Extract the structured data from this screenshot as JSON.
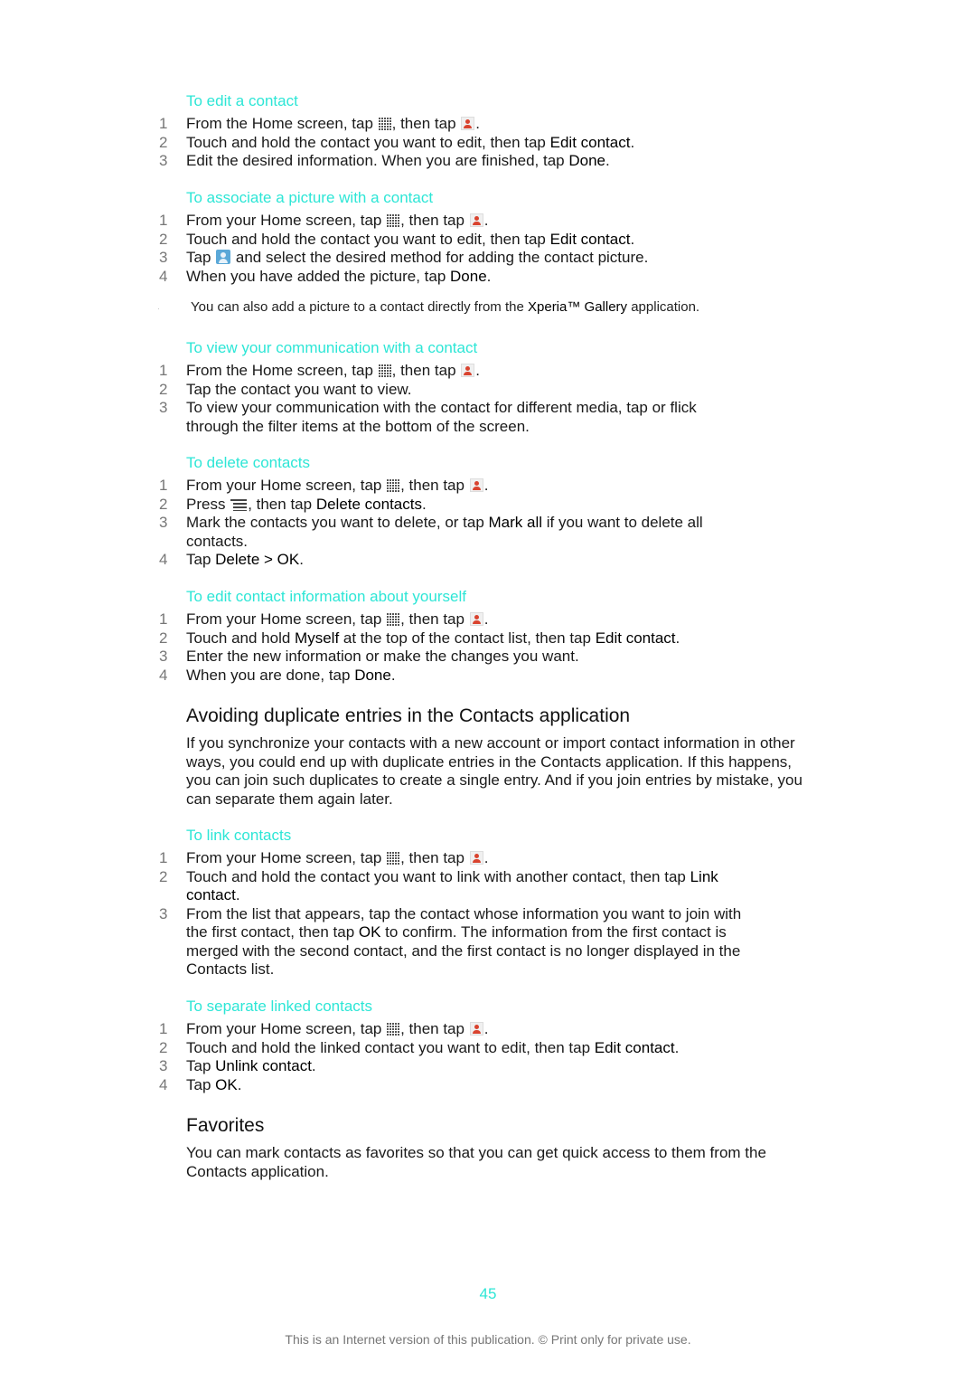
{
  "sections": {
    "edit_contact": {
      "title": "To edit a contact",
      "steps": [
        {
          "n": "1",
          "a": "From the Home screen, tap ",
          "b": ", then tap ",
          "c": "."
        },
        {
          "n": "2",
          "a": "Touch and hold the contact you want to edit, then tap ",
          "bold": "Edit contact",
          "c": "."
        },
        {
          "n": "3",
          "a": "Edit the desired information. When you are finished, tap ",
          "bold": "Done",
          "c": "."
        }
      ]
    },
    "associate_picture": {
      "title": "To associate a picture with a contact",
      "steps": [
        {
          "n": "1",
          "a": "From your Home screen, tap ",
          "b": ", then tap ",
          "c": "."
        },
        {
          "n": "2",
          "a": "Touch and hold the contact you want to edit, then tap ",
          "bold": "Edit contact",
          "c": "."
        },
        {
          "n": "3",
          "a": "Tap ",
          "b": " and select the desired method for adding the contact picture."
        },
        {
          "n": "4",
          "a": "When you have added the picture, tap ",
          "bold": "Done",
          "c": "."
        }
      ],
      "note": {
        "a": "You can also add a picture to a contact directly from the ",
        "bold": "Xperia™ Gallery",
        "c": " application."
      }
    },
    "view_communication": {
      "title": "To view your communication with a contact",
      "steps": [
        {
          "n": "1",
          "a": "From the Home screen, tap ",
          "b": ", then tap ",
          "c": "."
        },
        {
          "n": "2",
          "a": "Tap the contact you want to view."
        },
        {
          "n": "3",
          "a": "To view your communication with the contact for different media, tap or flick through the filter items at the bottom of the screen."
        }
      ]
    },
    "delete_contacts": {
      "title": "To delete contacts",
      "steps": [
        {
          "n": "1",
          "a": "From your Home screen, tap ",
          "b": ", then tap ",
          "c": "."
        },
        {
          "n": "2",
          "a": "Press ",
          "b": ", then tap ",
          "bold": "Delete contacts",
          "c": "."
        },
        {
          "n": "3",
          "a": "Mark the contacts you want to delete, or tap ",
          "bold": "Mark all",
          "c": " if you want to delete all contacts."
        },
        {
          "n": "4",
          "a": "Tap ",
          "bold": "Delete > OK",
          "c": "."
        }
      ]
    },
    "edit_yourself": {
      "title": "To edit contact information about yourself",
      "steps": [
        {
          "n": "1",
          "a": "From your Home screen, tap ",
          "b": ", then tap ",
          "c": "."
        },
        {
          "n": "2",
          "a": "Touch and hold ",
          "bold": "Myself",
          "b": " at the top of the contact list, then tap ",
          "bold2": "Edit contact",
          "c": "."
        },
        {
          "n": "3",
          "a": "Enter the new information or make the changes you want."
        },
        {
          "n": "4",
          "a": "When you are done, tap ",
          "bold": "Done",
          "c": "."
        }
      ]
    },
    "avoiding": {
      "heading": "Avoiding duplicate entries in the Contacts application",
      "paragraph": "If you synchronize your contacts with a new account or import contact information in other ways, you could end up with duplicate entries in the Contacts application. If this happens, you can join such duplicates to create a single entry. And if you join entries by mistake, you can separate them again later."
    },
    "link_contacts": {
      "title": "To link contacts",
      "steps": [
        {
          "n": "1",
          "a": "From your Home screen, tap ",
          "b": ", then tap ",
          "c": "."
        },
        {
          "n": "2",
          "a": "Touch and hold the contact you want to link with another contact, then tap ",
          "bold": "Link contact",
          "c": "."
        },
        {
          "n": "3",
          "a": "From the list that appears, tap the contact whose information you want to join with the first contact, then tap ",
          "bold": "OK",
          "c": " to confirm. The information from the first contact is merged with the second contact, and the first contact is no longer displayed in the Contacts list."
        }
      ]
    },
    "separate_linked": {
      "title": "To separate linked contacts",
      "steps": [
        {
          "n": "1",
          "a": "From your Home screen, tap ",
          "b": ", then tap ",
          "c": "."
        },
        {
          "n": "2",
          "a": "Touch and hold the linked contact you want to edit, then tap ",
          "bold": "Edit contact",
          "c": "."
        },
        {
          "n": "3",
          "a": "Tap ",
          "bold": "Unlink contact",
          "c": "."
        },
        {
          "n": "4",
          "a": "Tap ",
          "bold": "OK",
          "c": "."
        }
      ]
    },
    "favorites": {
      "heading": "Favorites",
      "paragraph": "You can mark contacts as favorites so that you can get quick access to them from the Contacts application."
    }
  },
  "icons": {
    "apps_grid": "apps-grid-icon",
    "contacts": "contacts-app-icon",
    "picture": "contact-picture-icon",
    "menu": "menu-key-icon"
  },
  "colors": {
    "accent": "#2de6d6"
  },
  "page_number": "45",
  "footer": "This is an Internet version of this publication. © Print only for private use."
}
